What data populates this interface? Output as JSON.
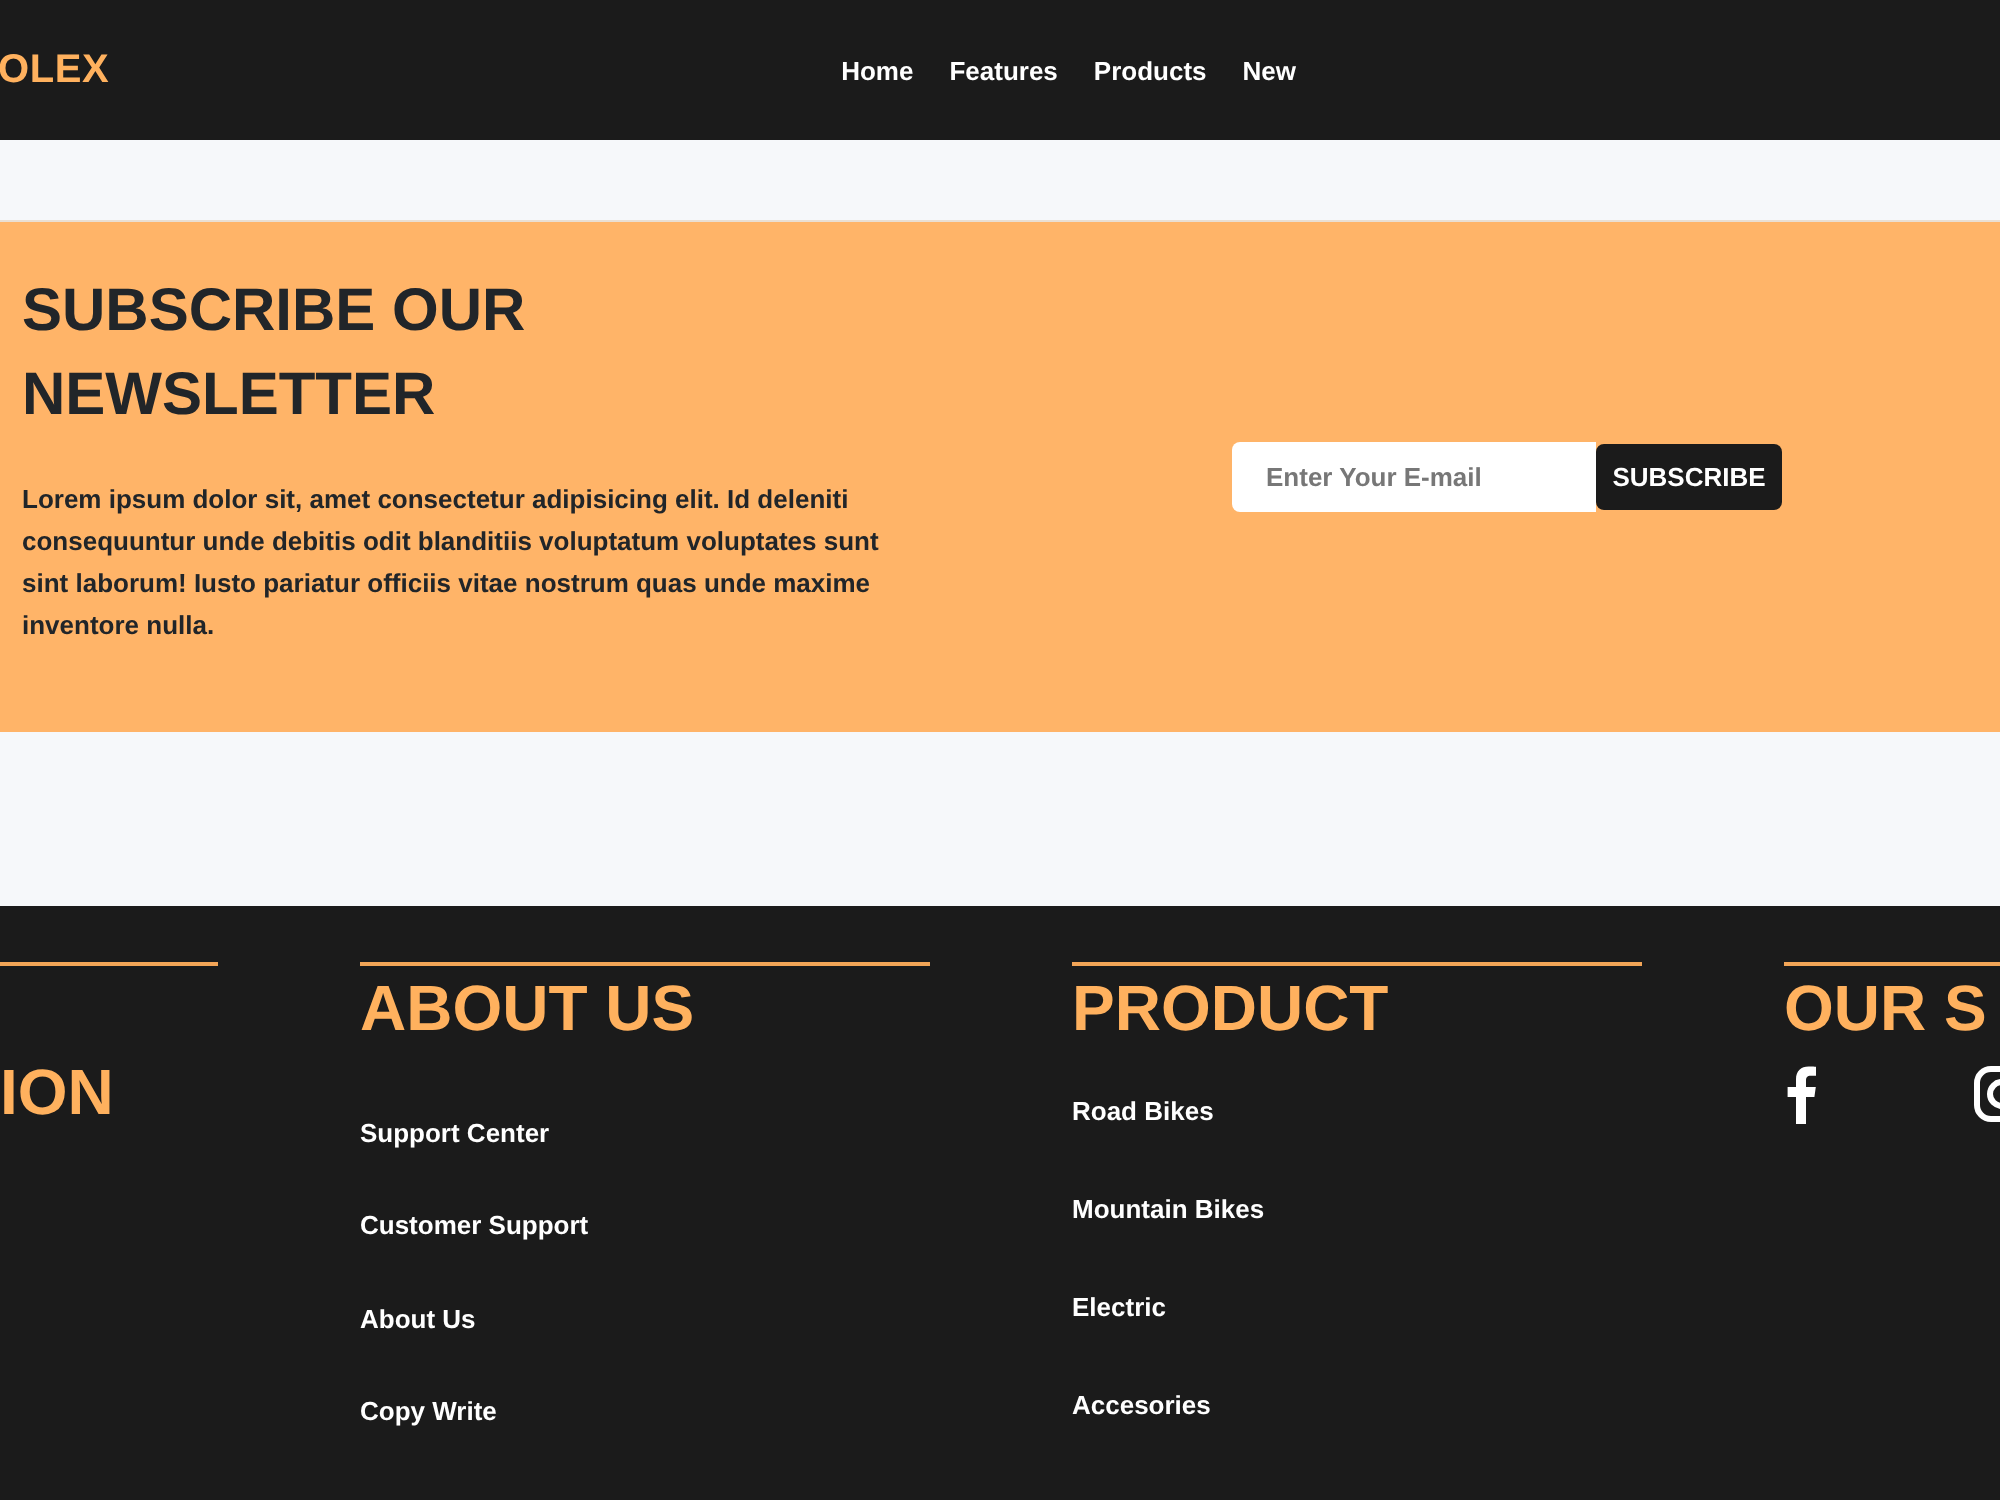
{
  "header": {
    "logo": "OLEX",
    "nav": [
      {
        "label": "Home"
      },
      {
        "label": "Features"
      },
      {
        "label": "Products"
      },
      {
        "label": "New"
      }
    ]
  },
  "newsletter": {
    "title": "SUBSCRIBE OUR NEWSLETTER",
    "text": "Lorem ipsum dolor sit, amet consectetur adipisicing elit. Id deleniti consequuntur unde debitis odit blanditiis voluptatum voluptates sunt sint laborum! Iusto pariatur officiis vitae nostrum quas unde maxime inventore nulla.",
    "email": {
      "placeholder": "Enter Your E-mail"
    },
    "button": "SUBSCRIBE"
  },
  "footer": {
    "columns": [
      {
        "heading": "ION"
      },
      {
        "heading": "ABOUT US",
        "links": [
          "Support Center",
          "Customer Support",
          "About Us",
          "Copy Write"
        ]
      },
      {
        "heading": "PRODUCT",
        "links": [
          "Road Bikes",
          "Mountain Bikes",
          "Electric",
          "Accesories"
        ]
      },
      {
        "heading": "OUR S",
        "social": [
          {
            "kind": "facebook"
          },
          {
            "kind": "instagram"
          }
        ]
      }
    ]
  }
}
